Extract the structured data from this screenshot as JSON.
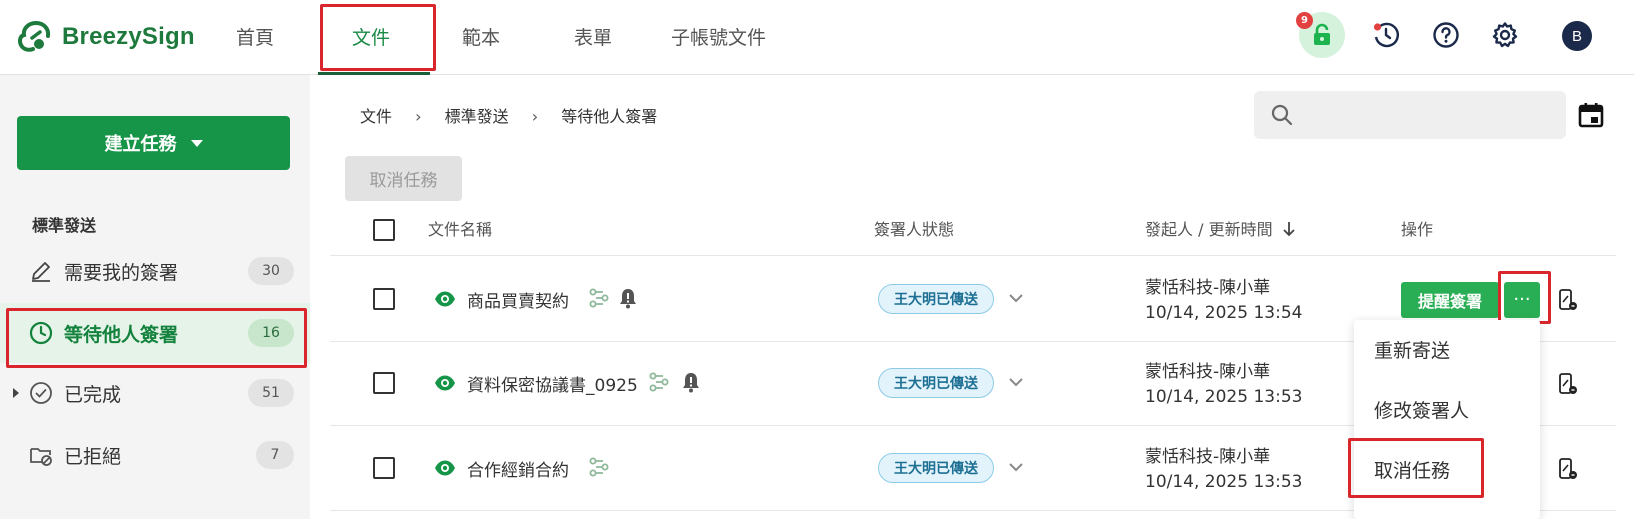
{
  "app": {
    "brand": "BreezySign"
  },
  "nav": {
    "items": [
      {
        "label": "首頁",
        "active": false
      },
      {
        "label": "文件",
        "active": true
      },
      {
        "label": "範本",
        "active": false
      },
      {
        "label": "表單",
        "active": false
      },
      {
        "label": "子帳號文件",
        "active": false
      }
    ]
  },
  "topbar": {
    "lock_badge": "9",
    "avatar_initial": "B",
    "icons": [
      "lock-icon",
      "history-icon",
      "help-icon",
      "settings-icon"
    ]
  },
  "sidebar": {
    "create_button": "建立任務",
    "section_title": "標準發送",
    "items": [
      {
        "label": "需要我的簽署",
        "count": "30",
        "icon": "pen-icon",
        "active": false
      },
      {
        "label": "等待他人簽署",
        "count": "16",
        "icon": "clock-icon",
        "active": true
      },
      {
        "label": "已完成",
        "count": "51",
        "icon": "check-circle-icon",
        "active": false,
        "expandable": true
      },
      {
        "label": "已拒絕",
        "count": "7",
        "icon": "folder-block-icon",
        "active": false
      }
    ]
  },
  "breadcrumb": [
    "文件",
    "標準發送",
    "等待他人簽署"
  ],
  "search": {
    "placeholder": "",
    "value": ""
  },
  "toolbar": {
    "cancel_task": "取消任務"
  },
  "table": {
    "columns": {
      "name": "文件名稱",
      "status": "簽署人狀態",
      "sender": "發起人 / 更新時間",
      "actions": "操作"
    },
    "rows": [
      {
        "name": "商品買賣契約",
        "status": "王大明已傳送",
        "sender": "蒙恬科技-陳小華",
        "time": "10/14, 2025 13:54",
        "has_bell": true
      },
      {
        "name": "資料保密協議書_0925",
        "status": "王大明已傳送",
        "sender": "蒙恬科技-陳小華",
        "time": "10/14, 2025 13:53",
        "has_bell": true
      },
      {
        "name": "合作經銷合約",
        "status": "王大明已傳送",
        "sender": "蒙恬科技-陳小華",
        "time": "10/14, 2025 13:53",
        "has_bell": false
      }
    ],
    "remind_button": "提醒簽署",
    "more_button": "···"
  },
  "dropdown": {
    "items": [
      "重新寄送",
      "修改簽署人",
      "取消任務"
    ]
  },
  "colors": {
    "brand_green": "#169447",
    "action_green": "#2aae55",
    "highlight_red": "#d9262c",
    "status_blue_bg": "#e3f3fb"
  }
}
